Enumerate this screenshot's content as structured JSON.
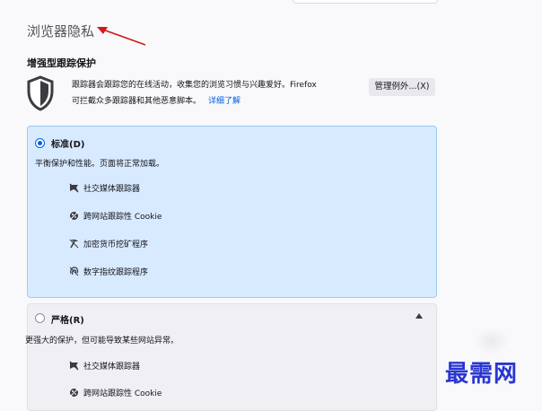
{
  "section": {
    "title": "浏览器隐私",
    "subtitle": "增强型跟踪保护",
    "description_line1": "跟踪器会跟踪您的在线活动，收集您的浏览习惯与兴趣爱好。Firefox",
    "description_line2": "可拦截众多跟踪器和其他恶意脚本。",
    "learn_more": "详细了解",
    "exceptions_button": "管理例外...(X)"
  },
  "options": {
    "standard": {
      "label": "标准(D)",
      "description": "平衡保护和性能。页面将正常加载。",
      "items": [
        {
          "icon": "social-tracker-icon",
          "label": "社交媒体跟踪器"
        },
        {
          "icon": "cookie-icon",
          "label": "跨网站跟踪性 Cookie"
        },
        {
          "icon": "cryptominer-icon",
          "label": "加密货币挖矿程序"
        },
        {
          "icon": "fingerprinter-icon",
          "label": "数字指纹跟踪程序"
        }
      ]
    },
    "strict": {
      "label": "严格(R)",
      "description": "更强大的保护，但可能导致某些网站异常。",
      "items": [
        {
          "icon": "social-tracker-icon",
          "label": "社交媒体跟踪器"
        },
        {
          "icon": "cookie-icon",
          "label": "跨网站跟踪性 Cookie"
        }
      ]
    }
  },
  "watermark": "最需网",
  "colors": {
    "accent": "#0061e0",
    "selected_card": "#d8eaff",
    "watermark": "#2a36d1",
    "annotation_arrow": "#d11a1a"
  }
}
